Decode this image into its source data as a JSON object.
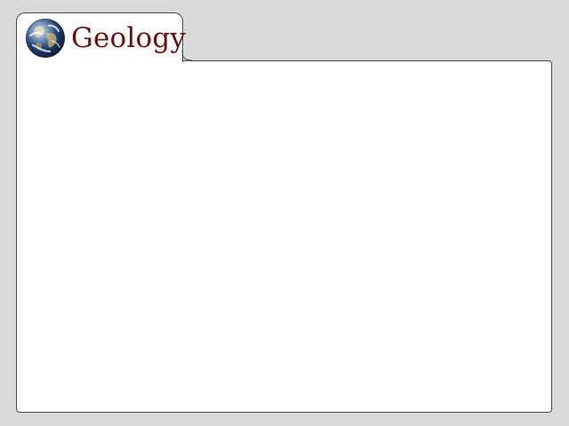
{
  "app": {
    "title": "Geology"
  },
  "tab": {
    "icon": "earth-globe-icon",
    "label": "Geology"
  },
  "colors": {
    "background": "#d9d9d9",
    "panel": "#ffffff",
    "border": "#4a4a4a",
    "title_text": "#6b0e0e"
  },
  "content": {
    "body_text": ""
  }
}
